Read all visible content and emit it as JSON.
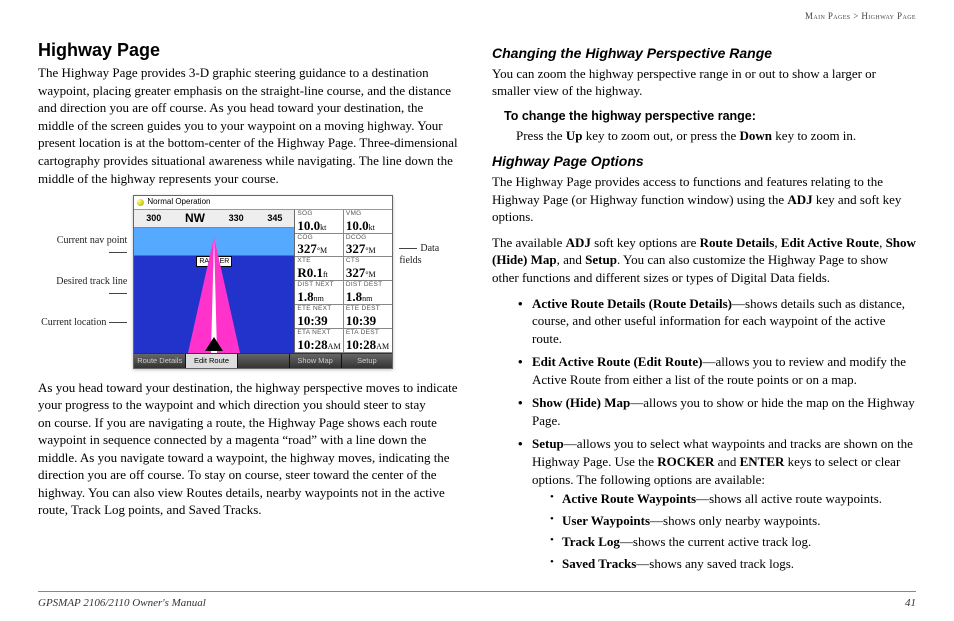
{
  "breadcrumb": {
    "left": "Main Pages",
    "sep": ">",
    "right": "Highway Page"
  },
  "h1": "Highway Page",
  "p1": "The Highway Page provides 3-D graphic steering guidance to a destination waypoint, placing greater emphasis on the straight-line course, and the distance and direction you are off course. As you head toward your destination, the middle of the screen guides you to your waypoint on a moving highway. Your present location is at the bottom-center of the Highway Page. Three-dimensional cartography provides situational awareness while navigating. The line down the middle of the highway represents your course.",
  "p2": "As you head toward your destination, the highway perspective moves to indicate your progress to the waypoint and which direction you should steer to stay on course. If you are navigating a route, the Highway Page shows each route waypoint in sequence connected by a magenta “road” with a line down the middle. As you navigate toward a waypoint, the highway moves, indicating the direction you are off course. To stay on course, steer toward the center of the highway. You can also view Routes details, nearby waypoints not in the active route, Track Log points, and Saved Tracks.",
  "fig": {
    "left": {
      "nav": "Current nav point",
      "track": "Desired track line",
      "loc": "Current location"
    },
    "right": {
      "data": "Data fields"
    },
    "title": "Normal Operation",
    "compass": {
      "a": "300",
      "nw": "NW",
      "b": "330",
      "c": "345"
    },
    "wpt": "RANGER",
    "cells": [
      {
        "lbl": "SOG",
        "val": "10.0",
        "unit": "kt"
      },
      {
        "lbl": "VMG",
        "val": "10.0",
        "unit": "kt"
      },
      {
        "lbl": "COG",
        "val": "327",
        "unit": "°M"
      },
      {
        "lbl": "DCOG",
        "val": "327",
        "unit": "°M"
      },
      {
        "lbl": "XTE",
        "val": "R0.1",
        "unit": "ft"
      },
      {
        "lbl": "CTS",
        "val": "327",
        "unit": "°M"
      },
      {
        "lbl": "DIST NEXT",
        "val": "1.8",
        "unit": "nm"
      },
      {
        "lbl": "DIST DEST",
        "val": "1.8",
        "unit": "nm"
      },
      {
        "lbl": "ETE NEXT",
        "val": "10:39",
        "unit": ""
      },
      {
        "lbl": "ETE DEST",
        "val": "10:39",
        "unit": ""
      },
      {
        "lbl": "ETA NEXT",
        "val": "10:28",
        "unit": "AM"
      },
      {
        "lbl": "ETA DEST",
        "val": "10:28",
        "unit": "AM"
      }
    ],
    "soft": {
      "a": "Route Details",
      "b": "Edit Route",
      "c": "Show Map",
      "d": "Setup"
    }
  },
  "h2a": "Changing the Highway Perspective Range",
  "p3": "You can zoom the highway perspective range in or out to show a larger or smaller view of the highway.",
  "h3a": "To change the highway perspective range:",
  "p4_pre": "Press the ",
  "p4_up": "Up",
  "p4_mid": " key to zoom out, or press the ",
  "p4_down": "Down",
  "p4_post": " key to zoom in.",
  "h2b": "Highway Page Options",
  "p5_a": "The Highway Page provides access to functions and features relating to the Highway Page (or Highway function window) using the ",
  "p5_adj": "ADJ",
  "p5_b": " key and soft key options.",
  "p6_a": "The available ",
  "p6_b": " soft key options are ",
  "p6_o1": "Route Details",
  "p6_s": ", ",
  "p6_o2": "Edit Active Route",
  "p6_o3": "Show (Hide) Map",
  "p6_and": ", and ",
  "p6_o4": "Setup",
  "p6_c": ". You can also customize the Highway Page to show other functions and different sizes or types of Digital Data fields.",
  "opts": [
    {
      "b": "Active Route Details (Route Details)",
      "t": "—shows details such as distance, course, and other useful information for each waypoint of the active route."
    },
    {
      "b": "Edit Active Route (Edit Route)",
      "t": "—allows you to review and modify the Active Route from either a list of the route points or on a map."
    },
    {
      "b": "Show (Hide) Map",
      "t": "—allows you to show or hide the map on the Highway Page."
    }
  ],
  "setup": {
    "b": "Setup",
    "t1": "—allows you to select what waypoints and tracks are shown on the Highway Page. Use the ",
    "k1": "ROCKER",
    "t2": " and ",
    "k2": "ENTER",
    "t3": " keys to select or clear options. The following options are available:"
  },
  "subs": [
    {
      "b": "Active Route Waypoints",
      "t": "—shows all active route waypoints."
    },
    {
      "b": "User Waypoints",
      "t": "—shows only nearby waypoints."
    },
    {
      "b": "Track Log",
      "t": "—shows the current active track log."
    },
    {
      "b": "Saved Tracks",
      "t": "—shows any saved track logs."
    }
  ],
  "footer": {
    "left": "GPSMAP 2106/2110 Owner's Manual",
    "right": "41"
  }
}
